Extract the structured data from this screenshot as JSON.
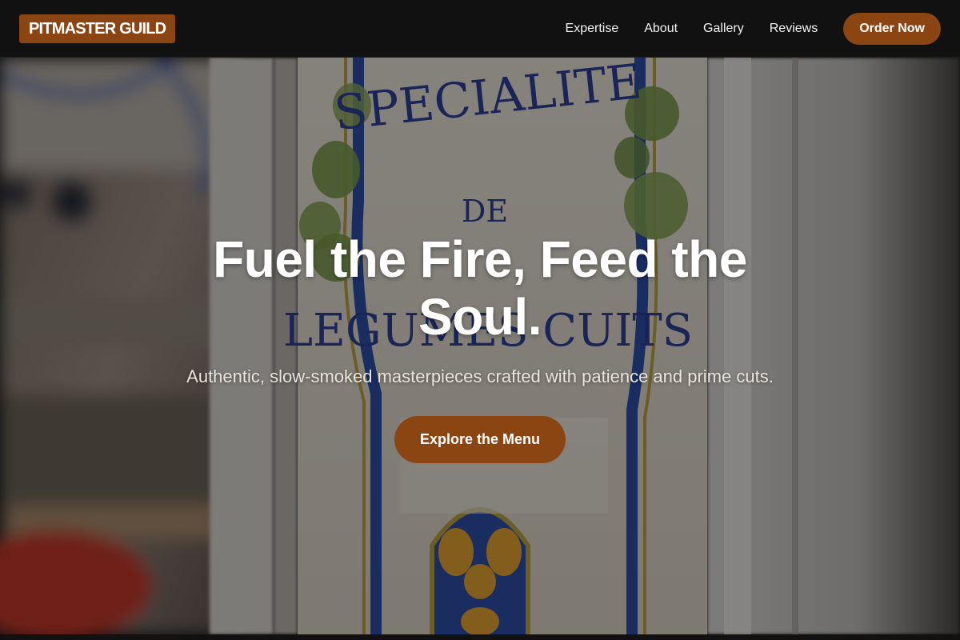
{
  "brand": {
    "logo_text": "PITMASTER GUILD"
  },
  "nav": {
    "links": [
      {
        "label": "Expertise"
      },
      {
        "label": "About"
      },
      {
        "label": "Gallery"
      },
      {
        "label": "Reviews"
      }
    ],
    "order_label": "Order Now"
  },
  "hero": {
    "headline": "Fuel the Fire, Feed the Soul.",
    "subheadline": "Authentic, slow-smoked masterpieces crafted with patience and prime cuts.",
    "cta_label": "Explore the Menu",
    "photo_text": {
      "line1": "SPECIALITE",
      "line2": "DE",
      "line3": "LEGUMES CUITS"
    }
  },
  "colors": {
    "accent": "#8b4513",
    "nav_background": "#111111",
    "headline": "#ffffff",
    "subheadline": "#e9e4dc"
  }
}
